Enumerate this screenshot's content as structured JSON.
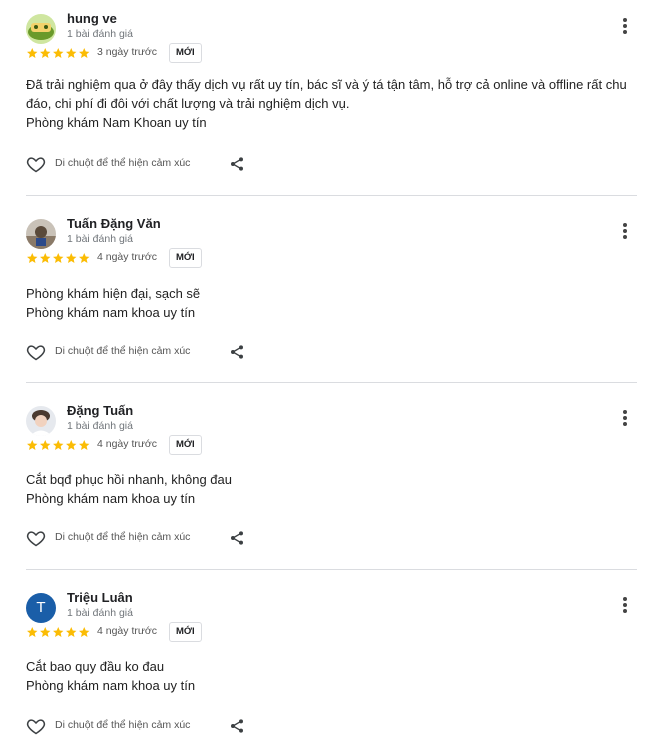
{
  "colors": {
    "star": "#fbbc04",
    "accent_avatar": "#1a5ea8",
    "divider": "#dadce0"
  },
  "icons": {
    "heart": "heart-icon",
    "share": "share-icon",
    "more": "more-vert-icon",
    "star": "star-icon"
  },
  "reviews": [
    {
      "name": "hung ve",
      "review_count": "1 bài đánh giá",
      "rating": 5,
      "date": "3 ngày trước",
      "badge": "MỚI",
      "text_lines": [
        "Đã trải nghiệm qua ở đây thấy dịch vụ rất uy tín, bác sĩ và ý tá tận tâm, hỗ trợ cả online và offline rất chu",
        "đáo, chi phí đi đôi với chất lượng và trải nghiệm dịch vụ.",
        "Phòng khám Nam Khoan uy tín"
      ],
      "react_label": "Di chuột để thể hiện cảm xúc"
    },
    {
      "name": "Tuấn Đặng Văn",
      "review_count": "1 bài đánh giá",
      "rating": 5,
      "date": "4 ngày trước",
      "badge": "MỚI",
      "text_lines": [
        "Phòng khám hiện đại, sạch sẽ",
        "Phòng khám nam khoa uy tín"
      ],
      "react_label": "Di chuột để thể hiện cảm xúc"
    },
    {
      "name": "Đặng Tuấn",
      "review_count": "1 bài đánh giá",
      "rating": 5,
      "date": "4 ngày trước",
      "badge": "MỚI",
      "text_lines": [
        "Cắt bqđ phục hồi nhanh, không đau",
        "Phòng khám nam khoa uy tín"
      ],
      "react_label": "Di chuột để thể hiện cảm xúc"
    },
    {
      "name": "Triệu Luân",
      "review_count": "1 bài đánh giá",
      "rating": 5,
      "date": "4 ngày trước",
      "badge": "MỚI",
      "avatar_letter": "T",
      "text_lines": [
        "Cắt bao quy đầu ko đau",
        "Phòng khám nam khoa uy tín"
      ],
      "react_label": "Di chuột để thể hiện cảm xúc"
    }
  ]
}
